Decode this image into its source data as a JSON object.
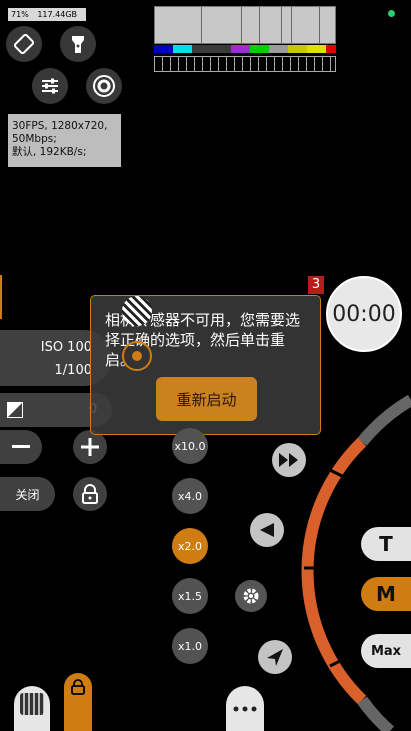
{
  "status": {
    "battery": "71%",
    "storage": "117.44GB"
  },
  "info_panel": {
    "line1": "30FPS, 1280x720,",
    "line2": "50Mbps;",
    "line3": "默认, 192KB/s;"
  },
  "exposure": {
    "iso": "ISO 100",
    "shutter": "1/100",
    "ev": "0"
  },
  "controls": {
    "off_label": "关闭"
  },
  "dialog": {
    "message": "相机传感器不可用，您需要选择正确的选项，然后单击重启。",
    "button": "重新启动"
  },
  "timer": {
    "value": "00:00",
    "badge": "3"
  },
  "zoom": {
    "levels": [
      "x10.0",
      "x4.0",
      "x2.0",
      "x1.5",
      "x1.0"
    ],
    "selected": "x2.0"
  },
  "modes": {
    "tele": "T",
    "manual": "M",
    "max": "Max"
  },
  "colors": {
    "accent": "#cf7c12",
    "ring": "#d9602a",
    "dialog_bg": "#3c3c3c"
  },
  "icons": [
    "rotate-icon",
    "flashlight-icon",
    "sliders-icon",
    "lens-icon",
    "exposure-icon",
    "minus-icon",
    "plus-icon",
    "lock-icon",
    "fast-forward-icon",
    "arrow-left-icon",
    "gear-icon",
    "grid-icon",
    "more-icon"
  ]
}
